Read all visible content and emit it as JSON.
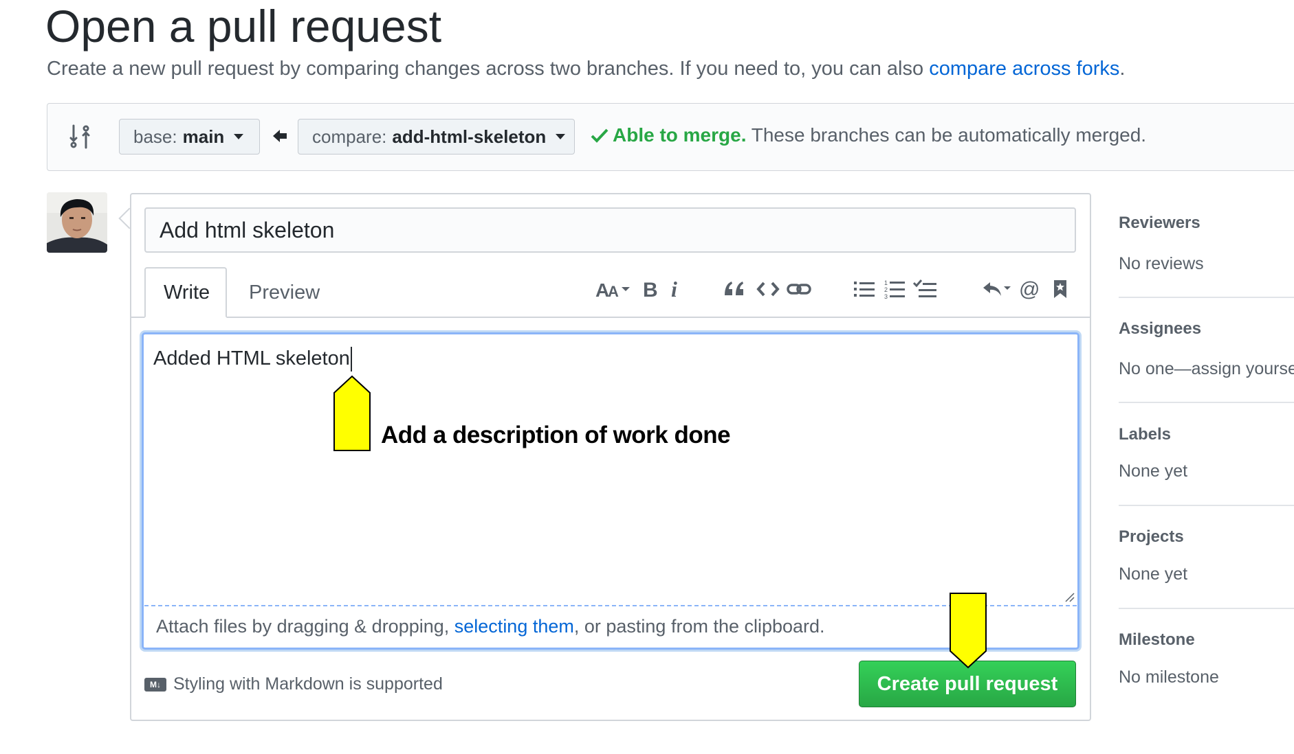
{
  "page": {
    "title": "Open a pull request",
    "subtitle_before": "Create a new pull request by comparing changes across two branches. If you need to, you can also ",
    "subtitle_link": "compare across forks",
    "subtitle_after": "."
  },
  "range": {
    "base_label": "base:",
    "base_value": "main",
    "compare_label": "compare:",
    "compare_value": "add-html-skeleton",
    "merge_ok": "Able to merge.",
    "merge_text": " These branches can be automatically merged."
  },
  "composer": {
    "title_value": "Add html skeleton",
    "tabs": {
      "write": "Write",
      "preview": "Preview"
    },
    "toolbar_icons": [
      "text-size-icon",
      "bold-icon",
      "italic-icon",
      "quote-icon",
      "code-icon",
      "link-icon",
      "unordered-list-icon",
      "ordered-list-icon",
      "task-list-icon",
      "reply-icon",
      "mention-icon",
      "reference-icon"
    ],
    "body_value": "Added HTML skeleton",
    "attach_before": "Attach files by dragging & dropping, ",
    "attach_link": "selecting them",
    "attach_after": ", or pasting from the clipboard.",
    "markdown_badge": "M↓",
    "markdown_note": "Styling with Markdown is supported",
    "submit_label": "Create pull request"
  },
  "sidebar": {
    "reviewers_heading": "Reviewers",
    "reviewers_value": "No reviews",
    "assignees_heading": "Assignees",
    "assignees_value": "No one—assign yourse",
    "labels_heading": "Labels",
    "labels_value": "None yet",
    "projects_heading": "Projects",
    "projects_value": "None yet",
    "milestone_heading": "Milestone",
    "milestone_value": "No milestone"
  },
  "annotation": {
    "text": "Add a description of work done",
    "arrow_color": "#ffff00"
  },
  "colors": {
    "link": "#0366d6",
    "success": "#28a745",
    "button_green": "#2cbe4e",
    "focus_border": "#8ab4f8"
  }
}
